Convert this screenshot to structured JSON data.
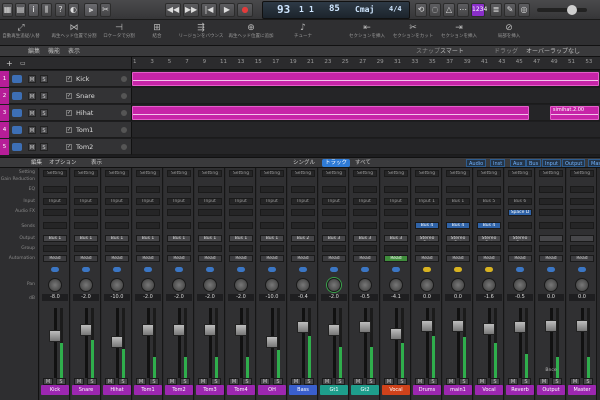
{
  "transport": {
    "position": "93",
    "beat": "1",
    "sub": "1",
    "tempo": "85",
    "key": "Cmaj",
    "signature": "4/4"
  },
  "control_icons": [
    "library-icon",
    "inspector-icon",
    "info-icon",
    "mixer-icon",
    "help-icon",
    "smart-controls-icon",
    "editors-icon",
    "scissors-icon"
  ],
  "right_icons": [
    "undo-icon",
    "list-editors-icon",
    "notepad-icon",
    "loop-browser-icon",
    "browser-icon"
  ],
  "cpu_badge": "1234",
  "toolbar": [
    {
      "icon": "auto-zoom-icon",
      "label": "自動再生追従/入替"
    },
    {
      "icon": "playhead-icon",
      "label": "再生ヘッド位置で分割"
    },
    {
      "icon": "locators-icon",
      "label": "ロケータで分割"
    },
    {
      "icon": "bounce-icon",
      "label": "結合"
    },
    {
      "icon": "normalize-icon",
      "label": "リージョンをバウンス"
    },
    {
      "icon": "snap-icon",
      "label": "再生ヘッド位置に追加"
    },
    {
      "icon": "tune-icon",
      "label": "チューナ"
    },
    {
      "icon": "insert-icon",
      "label": "セクションを挿入"
    },
    {
      "icon": "cut-section-icon",
      "label": "セクションをカット"
    },
    {
      "icon": "insert-silence-icon",
      "label": "セクションを挿入"
    },
    {
      "icon": "split-icon",
      "label": "局部を挿入"
    }
  ],
  "track_header": {
    "edit": "編集",
    "functions": "機能",
    "view": "表示",
    "snap_label": "スナップ",
    "snap_value": "スマート",
    "drag_label": "ドラッグ",
    "drag_value": "オーバーラップなし"
  },
  "ruler": [
    "1",
    "3",
    "5",
    "7",
    "9",
    "11",
    "13",
    "15",
    "17",
    "19",
    "21",
    "23",
    "25",
    "27",
    "29",
    "31",
    "33",
    "35",
    "37",
    "39",
    "41",
    "43",
    "45",
    "47",
    "49",
    "51",
    "53"
  ],
  "tracks": [
    {
      "num": "1",
      "name": "Kick",
      "regions": [
        {
          "start": 0,
          "end": 1
        }
      ]
    },
    {
      "num": "2",
      "name": "Snare",
      "regions": []
    },
    {
      "num": "3",
      "name": "Hihat",
      "regions": [
        {
          "start": 0,
          "end": 0.85
        },
        {
          "start": 0.893,
          "end": 1,
          "label": "simihat.2.00"
        }
      ]
    },
    {
      "num": "4",
      "name": "Tom1",
      "regions": []
    },
    {
      "num": "5",
      "name": "Tom2",
      "regions": []
    }
  ],
  "mixer_header": {
    "edit": "編集",
    "options": "オプション",
    "view": "表示",
    "tabs": [
      "シングル",
      "トラック",
      "すべて"
    ],
    "active_tab": "トラック",
    "views": [
      "Audio",
      "Inst",
      "Aux",
      "Bus",
      "Input",
      "Output",
      "Master"
    ]
  },
  "row_labels": [
    "Setting",
    "Gain Reduction",
    "EQ",
    "Input",
    "Audio FX",
    "Sends",
    "Output",
    "Group",
    "Automation",
    "",
    "Pan",
    "dB"
  ],
  "strip_defaults": {
    "setting": "Setting",
    "input": "Input",
    "output": "Bus 1",
    "automation": "Read",
    "m": "M",
    "s": "S"
  },
  "strips": [
    {
      "name": "Kick",
      "color": "#9c27b0",
      "output": "Bus 1",
      "db": "-8.0",
      "fader": 0.62,
      "meter": 0.5
    },
    {
      "name": "Snare",
      "color": "#9c27b0",
      "output": "Bus 1",
      "db": "-2.0",
      "fader": 0.72,
      "meter": 0.55
    },
    {
      "name": "Hihat",
      "color": "#9c27b0",
      "output": "Bus 1",
      "db": "-10.0",
      "fader": 0.52,
      "meter": 0.42
    },
    {
      "name": "Tom1",
      "color": "#9c27b0",
      "output": "Bus 1",
      "db": "-2.0",
      "fader": 0.72,
      "meter": 0.3
    },
    {
      "name": "Tom2",
      "color": "#9c27b0",
      "output": "Bus 1",
      "db": "-2.0",
      "fader": 0.72,
      "meter": 0.3
    },
    {
      "name": "Tom3",
      "color": "#9c27b0",
      "output": "Bus 1",
      "db": "-2.0",
      "fader": 0.72,
      "meter": 0.3
    },
    {
      "name": "Tom4",
      "color": "#9c27b0",
      "output": "Bus 1",
      "db": "-2.0",
      "fader": 0.72,
      "meter": 0.3
    },
    {
      "name": "OH",
      "color": "#9c27b0",
      "output": "Bus 1",
      "db": "-10.0",
      "fader": 0.52,
      "meter": 0.4
    },
    {
      "name": "Bass",
      "color": "#3a5fcd",
      "output": "Bus 2",
      "db": "-0.4",
      "fader": 0.78,
      "meter": 0.6
    },
    {
      "name": "Gt1",
      "color": "#1e9e8c",
      "output": "Bus 3",
      "db": "-2.0",
      "fader": 0.72,
      "meter": 0.45,
      "pan_green": true
    },
    {
      "name": "Gt2",
      "color": "#1e9e8c",
      "output": "Bus 3",
      "db": "-0.5",
      "fader": 0.77,
      "meter": 0.45
    },
    {
      "name": "Vocal",
      "color": "#d0421b",
      "output": "Bus 3",
      "db": "-4.1",
      "fader": 0.66,
      "meter": 0.5,
      "auto_green": true
    },
    {
      "name": "Drums",
      "color": "#9c27b0",
      "input": "Input 1",
      "output": "Stereo Out",
      "db": "0.0",
      "fader": 0.8,
      "meter": 0.6,
      "send": "Bus 4",
      "link": "yellow"
    },
    {
      "name": "main1",
      "color": "#9c27b0",
      "input": "Bus 1",
      "output": "Stereo Out",
      "db": "0.0",
      "fader": 0.8,
      "meter": 0.58,
      "send": "Bus 4",
      "link": "yellow"
    },
    {
      "name": "Vocal",
      "color": "#9c27b0",
      "input": "Bus 5",
      "output": "Stereo Out",
      "db": "-1.6",
      "fader": 0.75,
      "meter": 0.5,
      "send": "Bus 4",
      "link": "yellow"
    },
    {
      "name": "Reverb",
      "color": "#9c27b0",
      "input": "Bus 6",
      "output": "Stereo Out",
      "db": "-0.5",
      "fader": 0.78,
      "meter": 0.35,
      "fx": "Space D"
    },
    {
      "name": "Output",
      "color": "#9c27b0",
      "input": "",
      "output": "",
      "db": "0.0",
      "fader": 0.8,
      "meter": 0.3,
      "footer": "Bnce"
    },
    {
      "name": "Master",
      "color": "#9c27b0",
      "input": "",
      "output": "",
      "db": "0.0",
      "fader": 0.8,
      "meter": 0.3
    }
  ]
}
